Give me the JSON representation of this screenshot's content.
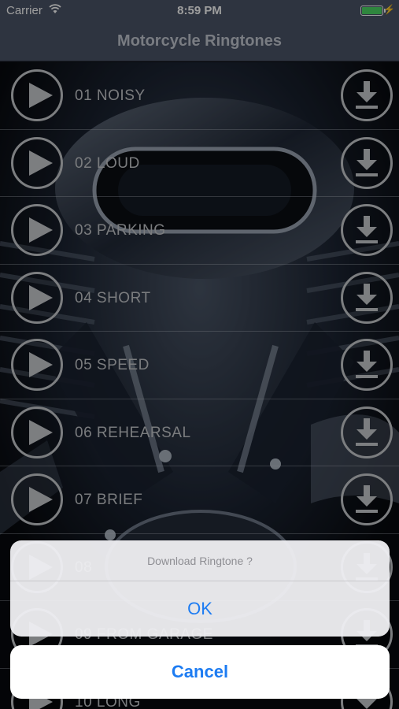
{
  "status_bar": {
    "carrier": "Carrier",
    "time": "8:59 PM",
    "battery_level": 1.0,
    "battery_color": "#4cd964",
    "wifi_icon": "wifi-icon",
    "charging_icon": "bolt-icon"
  },
  "nav": {
    "title": "Motorcycle Ringtones"
  },
  "ringtones": [
    {
      "title": "01 NOISY"
    },
    {
      "title": "02 LOUD"
    },
    {
      "title": "03 PARKING"
    },
    {
      "title": "04 SHORT"
    },
    {
      "title": "05 SPEED"
    },
    {
      "title": "06 REHEARSAL"
    },
    {
      "title": "07 BRIEF"
    },
    {
      "title": "08"
    },
    {
      "title": "09 FROM GARAGE"
    },
    {
      "title": "10 LONG"
    }
  ],
  "icons": {
    "play": "play-icon",
    "download": "download-icon"
  },
  "alert": {
    "message": "Download Ringtone ?",
    "ok_label": "OK",
    "cancel_label": "Cancel",
    "accent_color": "#1d7cf2"
  }
}
